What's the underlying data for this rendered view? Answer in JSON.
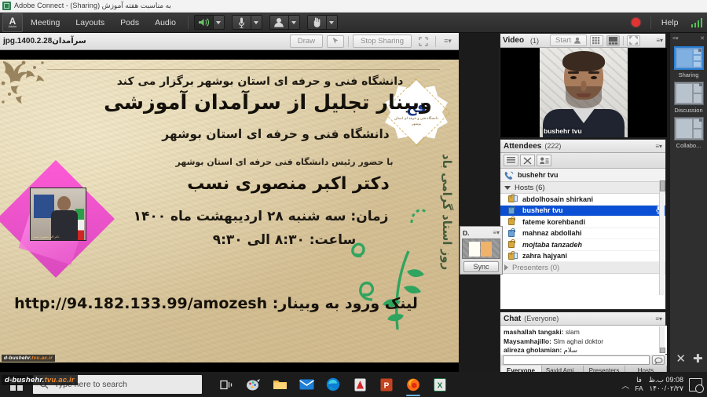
{
  "window": {
    "title": "به مناسبت هفته آموزش (Sharing) - Adobe Connect",
    "app_icon": "adobe-connect-icon"
  },
  "menubar": {
    "items": [
      {
        "label": "Meeting"
      },
      {
        "label": "Layouts"
      },
      {
        "label": "Pods"
      },
      {
        "label": "Audio"
      }
    ],
    "av_controls": [
      {
        "name": "speaker-button",
        "icon": "speaker-icon",
        "state": "on"
      },
      {
        "name": "microphone-button",
        "icon": "microphone-icon",
        "state": "off"
      },
      {
        "name": "camera-button",
        "icon": "webcam-icon",
        "state": "off"
      },
      {
        "name": "raise-hand-button",
        "icon": "raise-hand-icon",
        "state": "off"
      }
    ],
    "recording_indicator": "recording-dot",
    "help_label": "Help",
    "connection_icon": "signal-bars-icon"
  },
  "share_pod": {
    "file_name": "سرآمدان1400.2.28.jpg",
    "draw_label": "Draw",
    "pointer_icon": "pointer-icon",
    "stop_sharing_label": "Stop Sharing",
    "fullscreen_icon": "fullscreen-icon",
    "menu_icon": "pod-menu-icon",
    "slide": {
      "line1": "دانشگاه فنی و حرفه ای استان بوشهر برگزار می کند",
      "line2": "وبینار تجلیل از سرآمدان آموزشی",
      "line3": "دانشگاه فنی و حرفه ای استان بوشهر",
      "line4": "با حضور رئیس دانشگاه فنی حرفه ای استان بوشهر",
      "line5": "دکتر اکبر منصوری نسب",
      "line6": "زمان: سه شنبه ۲۸ اردیبهشت ماه ۱۴۰۰",
      "line7": "ساعت: ۸:۳۰ الی ۹:۳۰",
      "line8": "لینک ورود به وبینار: http://94.182.133.99/amozesh",
      "vertical_text": "روز استاد گرامی باد",
      "badge_glyph": "فح",
      "badge_caption": "دانشگاه فنی و حرفه ای\nاستان بوشهر",
      "photo_caption": "دکتر اکبر منصوری نسب",
      "watermark_a": "d-bushehr.",
      "watermark_b": "tvu.ac.ir"
    }
  },
  "doc_pod": {
    "title": "D.",
    "sync_label": "Sync",
    "menu_icon": "pod-menu-icon"
  },
  "video_pod": {
    "title": "Video",
    "count": "(1)",
    "start_label": "Start",
    "start_icon": "webcam-icon",
    "grid_icon": "grid-view-icon",
    "filmstrip_icon": "filmstrip-view-icon",
    "fullscreen_icon": "fullscreen-icon",
    "menu_icon": "pod-menu-icon",
    "participant_name": "bushehr tvu"
  },
  "attendees_pod": {
    "title": "Attendees",
    "count": "(222)",
    "menu_icon": "pod-menu-icon",
    "tools": [
      {
        "name": "attendee-list-view-button",
        "icon": "list-view-icon"
      },
      {
        "name": "breakout-rooms-button",
        "icon": "breakout-icon"
      },
      {
        "name": "attendee-options-button",
        "icon": "person-options-icon"
      }
    ],
    "self_row": {
      "name": "bushehr tvu",
      "icon": "phone-audio-icon"
    },
    "groups": [
      {
        "label": "Hosts (6)",
        "expanded": true,
        "members": [
          {
            "name": "abdolhosain shirkani",
            "icon": "host-with-screen-icon",
            "selected": false,
            "italic": false
          },
          {
            "name": "bushehr tvu",
            "icon": "host-icon",
            "selected": true,
            "italic": false,
            "mic_icon": "microphone-icon"
          },
          {
            "name": "fateme korehbandi",
            "icon": "host-icon",
            "selected": false,
            "italic": false
          },
          {
            "name": "mahnaz abdollahi",
            "icon": "host-icon-blue",
            "selected": false,
            "italic": false
          },
          {
            "name": "mojtaba tanzadeh",
            "icon": "host-icon",
            "selected": false,
            "italic": true
          },
          {
            "name": "zahra hajyani",
            "icon": "host-with-screen-icon",
            "selected": false,
            "italic": false
          }
        ]
      },
      {
        "label": "Presenters (0)",
        "expanded": false,
        "members": []
      }
    ]
  },
  "chat_pod": {
    "title": "Chat",
    "scope": "(Everyone)",
    "menu_icon": "pod-menu-icon",
    "messages": [
      {
        "sender": "mashallah tangaki:",
        "text": "slam"
      },
      {
        "sender": "Maysamhajillo:",
        "text": "Slm aghai doktor"
      },
      {
        "sender": "alireza gholamian:",
        "text": "سلام"
      }
    ],
    "input_value": "",
    "input_placeholder": "",
    "send_icon": "chat-bubble-icon",
    "tabs": [
      {
        "label": "Everyone",
        "active": true
      },
      {
        "label": "Sayid Ami...",
        "active": false
      },
      {
        "label": "Presenters",
        "active": false
      },
      {
        "label": "Hosts",
        "active": false
      }
    ]
  },
  "layout_rail": {
    "menu_icon": "pod-menu-icon",
    "close_icon": "close-icon",
    "items": [
      {
        "label": "Sharing",
        "selected": true
      },
      {
        "label": "Discussion",
        "selected": false
      },
      {
        "label": "Collabo...",
        "selected": false
      }
    ],
    "buttons": [
      {
        "name": "close-layout-button",
        "glyph": "✕"
      },
      {
        "name": "add-layout-button",
        "glyph": "✚"
      }
    ]
  },
  "taskbar": {
    "start_icon": "windows-start-icon",
    "search_placeholder": "Type here to search",
    "search_icon": "search-icon",
    "task_view_icon": "task-view-icon",
    "apps": [
      {
        "name": "adobe-connect-taskbar-icon",
        "glyph": "◍",
        "color": "#b9c7d4",
        "running": false
      },
      {
        "name": "file-explorer-taskbar-icon",
        "glyph": "▰",
        "color": "#f0c14b",
        "running": false
      },
      {
        "name": "mail-taskbar-icon",
        "glyph": "✉",
        "color": "#2f7fd8",
        "running": false
      },
      {
        "name": "edge-taskbar-icon",
        "glyph": "◉",
        "color": "#0f8ce0",
        "running": false
      },
      {
        "name": "acrobat-reader-taskbar-icon",
        "glyph": "A",
        "color": "#d8232a",
        "running": false
      },
      {
        "name": "powerpoint-taskbar-icon",
        "glyph": "P",
        "color": "#c5431f",
        "running": false
      },
      {
        "name": "firefox-taskbar-icon",
        "glyph": "◕",
        "color": "#e8660b",
        "running": true
      },
      {
        "name": "excel-taskbar-icon",
        "glyph": "X",
        "color": "#1f7244",
        "running": false
      }
    ],
    "tray": {
      "chevron": "︿",
      "lang_top": "فا",
      "lang_bottom": "FA",
      "time": "09:08 ب.ظ",
      "date": "۱۴۰۰/۰۲/۲۷",
      "notification_icon": "action-center-icon"
    },
    "watermark_a": "d-bushehr.",
    "watermark_b": "tvu.ac.ir"
  }
}
